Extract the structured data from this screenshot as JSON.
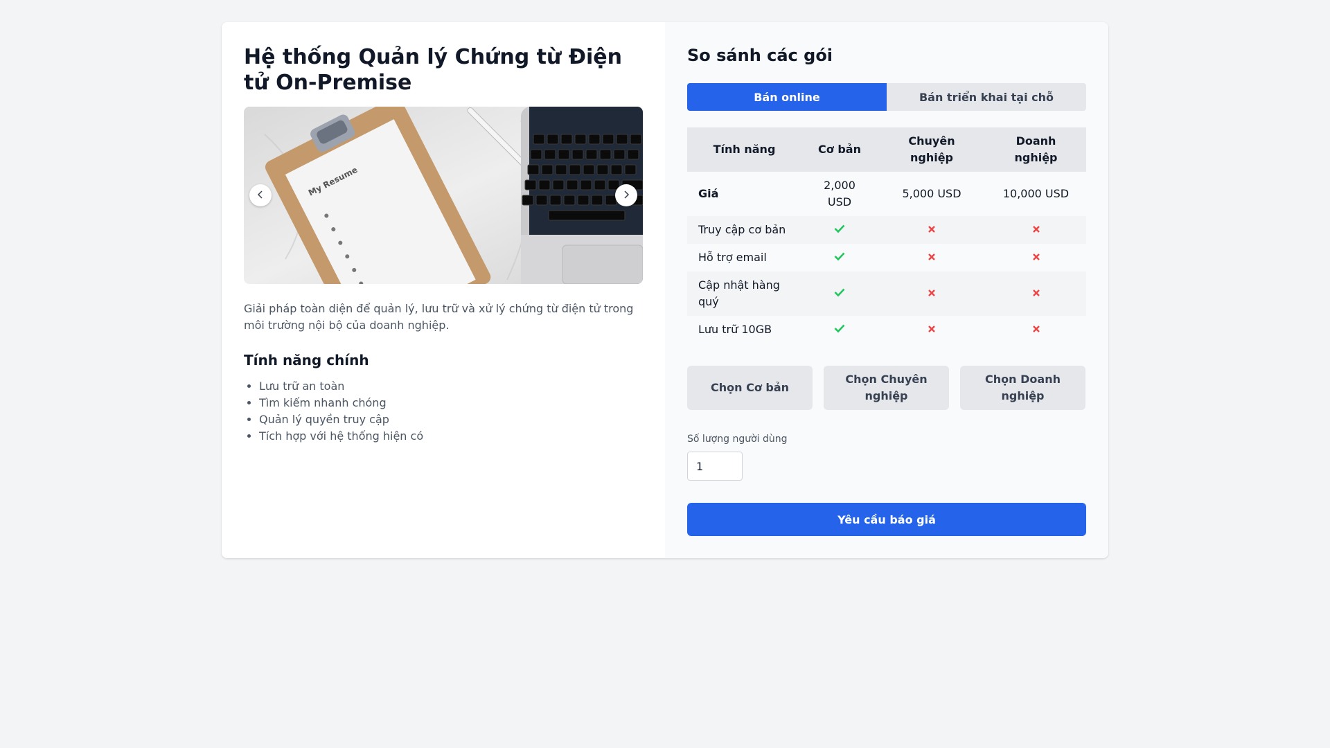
{
  "product": {
    "title": "Hệ thống Quản lý Chứng từ Điện tử On-Premise",
    "description": "Giải pháp toàn diện để quản lý, lưu trữ và xử lý chứng từ điện tử trong môi trường nội bộ của doanh nghiệp.",
    "features_title": "Tính năng chính",
    "features": [
      "Lưu trữ an toàn",
      "Tìm kiếm nhanh chóng",
      "Quản lý quyền truy cập",
      "Tích hợp với hệ thống hiện có"
    ],
    "carousel": {
      "image_caption": "My Resume",
      "prev_icon": "chevron-left-icon",
      "next_icon": "chevron-right-icon"
    }
  },
  "plans": {
    "title": "So sánh các gói",
    "tabs": [
      {
        "label": "Bán online",
        "active": true
      },
      {
        "label": "Bán triển khai tại chỗ",
        "active": false
      }
    ],
    "table": {
      "headers": [
        "Tính năng",
        "Cơ bản",
        "Chuyên nghiệp",
        "Doanh nghiệp"
      ],
      "price_row": {
        "label": "Giá",
        "values": [
          "2,000 USD",
          "5,000 USD",
          "10,000 USD"
        ]
      },
      "rows": [
        {
          "label": "Truy cập cơ bản",
          "values": [
            true,
            false,
            false
          ]
        },
        {
          "label": "Hỗ trợ email",
          "values": [
            true,
            false,
            false
          ]
        },
        {
          "label": "Cập nhật hàng quý",
          "values": [
            true,
            false,
            false
          ]
        },
        {
          "label": "Lưu trữ 10GB",
          "values": [
            true,
            false,
            false
          ]
        }
      ]
    },
    "buttons": [
      "Chọn Cơ bản",
      "Chọn Chuyên nghiệp",
      "Chọn Doanh nghiệp"
    ],
    "users_label": "Số lượng người dùng",
    "users_value": "1",
    "quote_button": "Yêu cầu báo giá"
  },
  "colors": {
    "primary": "#2563eb",
    "check": "#22c55e",
    "cross": "#ef4444"
  }
}
